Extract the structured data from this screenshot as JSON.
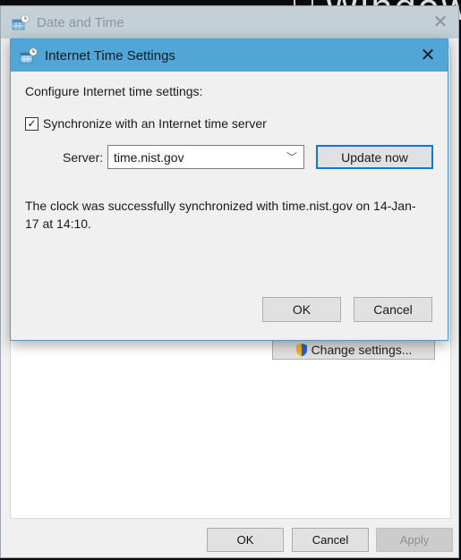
{
  "background": {
    "desktop_text": "Windows"
  },
  "outer_window": {
    "title": "Date and Time",
    "close_icon": "close-icon",
    "change_settings_label": "Change settings...",
    "buttons": {
      "ok": "OK",
      "cancel": "Cancel",
      "apply": "Apply"
    }
  },
  "dialog": {
    "title": "Internet Time Settings",
    "close_icon": "close-icon",
    "configure_label": "Configure Internet time settings:",
    "sync_checkbox": {
      "label": "Synchronize with an Internet time server",
      "checked": true
    },
    "server": {
      "label": "Server:",
      "value": "time.nist.gov"
    },
    "update_button": "Update now",
    "status_message": "The clock was successfully synchronized with time.nist.gov on 14-Jan-17 at 14:10.",
    "buttons": {
      "ok": "OK",
      "cancel": "Cancel"
    }
  },
  "colors": {
    "dialog_title_bar": "#52a6d6",
    "outer_title_bar": "#c4d0d8",
    "focus_border": "#0f78d4"
  }
}
